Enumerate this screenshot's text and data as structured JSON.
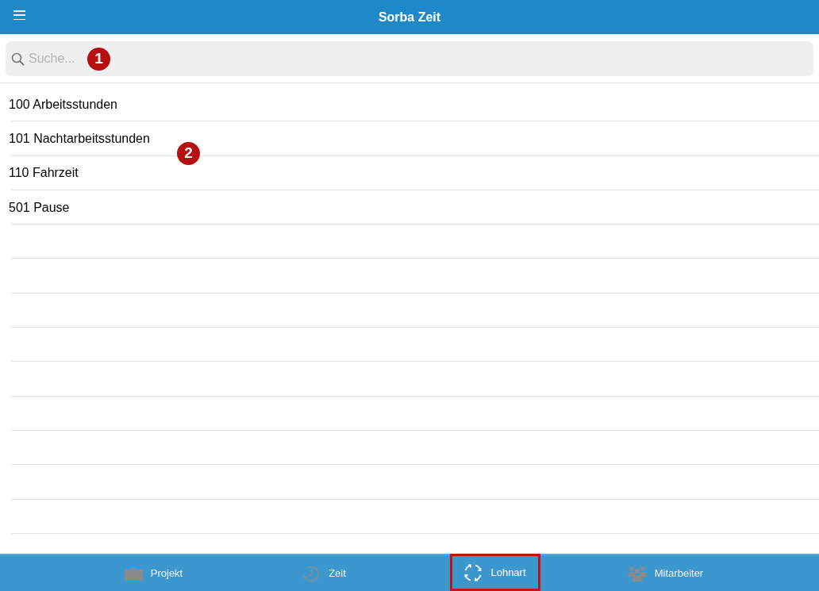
{
  "header": {
    "title": "Sorba Zeit"
  },
  "search": {
    "placeholder": "Suche..."
  },
  "list": {
    "items": [
      "100 Arbeitsstunden",
      "101 Nachtarbeitsstunden",
      "110 Fahrzeit",
      "501 Pause"
    ]
  },
  "callouts": [
    "1",
    "2"
  ],
  "tabs": [
    {
      "kind": "briefcase",
      "label": "Projekt",
      "selected": false
    },
    {
      "kind": "clock",
      "label": "Zeit",
      "selected": false
    },
    {
      "kind": "cycle",
      "label": "Lohnart",
      "selected": true
    },
    {
      "kind": "people",
      "label": "Mitarbeiter",
      "selected": false
    }
  ]
}
